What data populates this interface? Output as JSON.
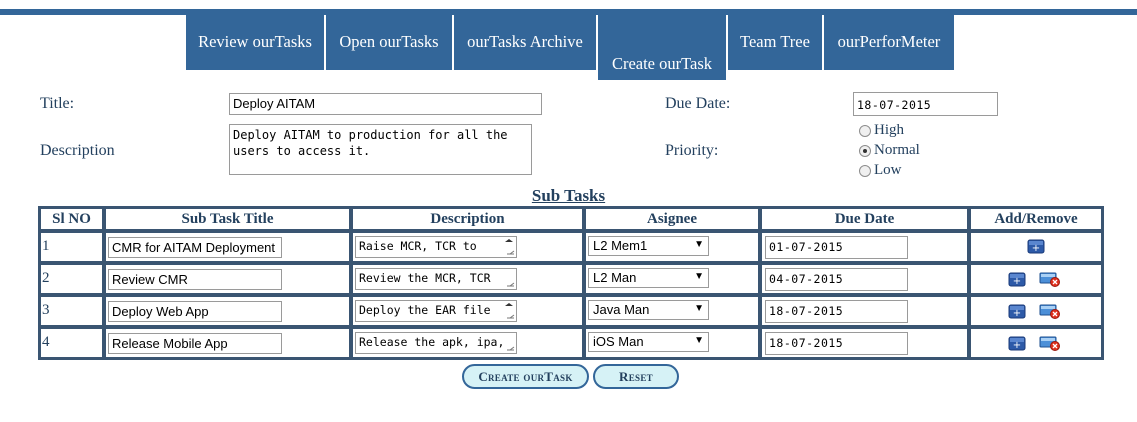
{
  "nav": {
    "tabs": [
      {
        "label": "Review ourTasks"
      },
      {
        "label": "Open ourTasks"
      },
      {
        "label": "ourTasks Archive"
      },
      {
        "label": "Create ourTask"
      },
      {
        "label": "Team Tree"
      },
      {
        "label": "ourPerforMeter"
      }
    ],
    "active_tab": "Create ourTask"
  },
  "form": {
    "title_label": "Title:",
    "title_value": "Deploy AITAM",
    "description_label": "Description",
    "description_value": "Deploy AITAM to production for all the\nusers to access it.",
    "due_date_label": "Due Date:",
    "due_date_value": "18-07-2015",
    "priority_label": "Priority:",
    "priority_options": [
      "High",
      "Normal",
      "Low"
    ],
    "priority_selected": "Normal"
  },
  "subtasks": {
    "heading": "Sub Tasks",
    "columns": [
      "Sl NO",
      "Sub Task Title",
      "Description",
      "Asignee",
      "Due Date",
      "Add/Remove"
    ],
    "rows": [
      {
        "sl": "1",
        "title": "CMR for AITAM Deployment",
        "description": "Raise MCR, TCR to",
        "assignee": "L2 Mem1",
        "due": "01-07-2015"
      },
      {
        "sl": "2",
        "title": "Review CMR",
        "description": "Review the MCR, TCR",
        "assignee": "L2 Man",
        "due": "04-07-2015"
      },
      {
        "sl": "3",
        "title": "Deploy Web App",
        "description": "Deploy the EAR file",
        "assignee": "Java Man",
        "due": "18-07-2015"
      },
      {
        "sl": "4",
        "title": "Release Mobile App",
        "description": "Release the apk, ipa,",
        "assignee": "iOS Man",
        "due": "18-07-2015"
      }
    ]
  },
  "buttons": {
    "create": "Create ourTask",
    "reset": "Reset"
  },
  "colors": {
    "nav_bg": "#336699",
    "text": "#23405e",
    "button_bg": "#d6f2f6"
  }
}
